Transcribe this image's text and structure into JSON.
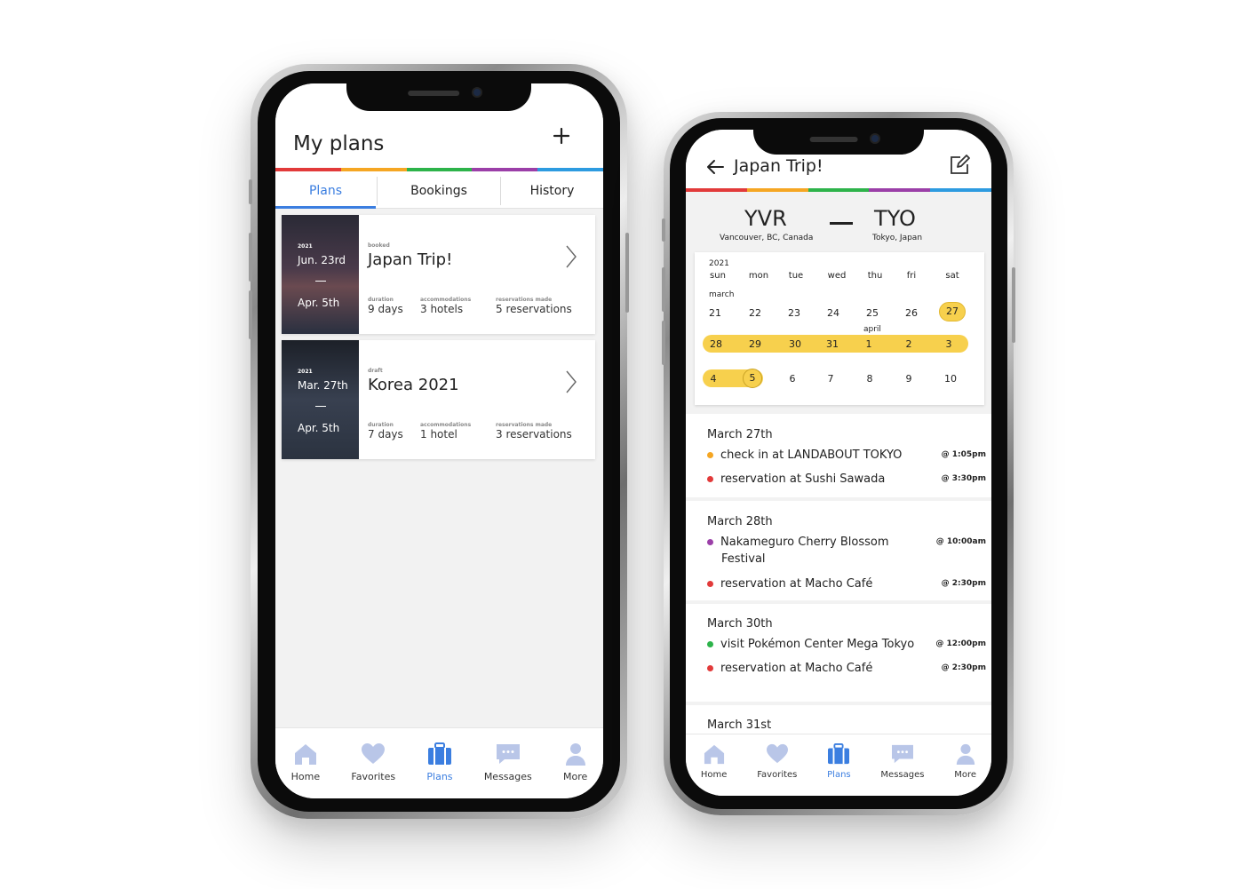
{
  "colors": {
    "red": "#e23a3a",
    "orange": "#f5a623",
    "green": "#2db34a",
    "purple": "#9b3fa8",
    "blue": "#2d9be0",
    "accent": "#3b7ee0",
    "yellow": "#f7d04d"
  },
  "left": {
    "title": "My plans",
    "add_icon": "plus-icon",
    "tabs": [
      "Plans",
      "Bookings",
      "History"
    ],
    "cards": [
      {
        "year": "2021",
        "start": "Jun. 23rd",
        "end": "Apr. 5th",
        "status": "booked",
        "name": "Japan Trip!",
        "duration_label": "duration",
        "duration": "9 days",
        "acc_label": "accommodations",
        "acc": "3 hotels",
        "res_label": "reservations made",
        "res": "5 reservations"
      },
      {
        "year": "2021",
        "start": "Mar. 27th",
        "end": "Apr. 5th",
        "status": "draft",
        "name": "Korea 2021",
        "duration_label": "duration",
        "duration": "7 days",
        "acc_label": "accommodations",
        "acc": "1 hotel",
        "res_label": "reservations made",
        "res": "3 reservations"
      }
    ],
    "nav": [
      "Home",
      "Favorites",
      "Plans",
      "Messages",
      "More"
    ]
  },
  "right": {
    "title": "Japan Trip!",
    "from_code": "YVR",
    "from_city": "Vancouver, BC, Canada",
    "to_code": "TYO",
    "to_city": "Tokyo, Japan",
    "dash": "—",
    "cal": {
      "year": "2021",
      "weekdays": [
        "sun",
        "mon",
        "tue",
        "wed",
        "thu",
        "fri",
        "sat"
      ],
      "month1": "march",
      "month2": "april",
      "week1": [
        "21",
        "22",
        "23",
        "24",
        "25",
        "26",
        "27"
      ],
      "week2": [
        "28",
        "29",
        "30",
        "31",
        "1",
        "2",
        "3"
      ],
      "week3": [
        "4",
        "5",
        "6",
        "7",
        "8",
        "9",
        "10"
      ]
    },
    "days": [
      {
        "date": "March 27th",
        "events": [
          {
            "text": "check in at LANDABOUT TOKYO",
            "time": "@ 1:05pm",
            "color": "#f5a623"
          },
          {
            "text": "reservation at Sushi Sawada",
            "time": "@ 3:30pm",
            "color": "#e23a3a"
          }
        ]
      },
      {
        "date": "March 28th",
        "events": [
          {
            "text": "Nakameguro Cherry Blossom",
            "text2": "Festival",
            "time": "@ 10:00am",
            "color": "#9b3fa8"
          },
          {
            "text": "reservation at Macho Café",
            "time": "@ 2:30pm",
            "color": "#e23a3a"
          }
        ]
      },
      {
        "date": "March 30th",
        "events": [
          {
            "text": "visit Pokémon Center Mega Tokyo",
            "time": "@ 12:00pm",
            "color": "#2db34a"
          },
          {
            "text": "reservation at Macho Café",
            "time": "@ 2:30pm",
            "color": "#e23a3a"
          }
        ]
      },
      {
        "date": "March 31st"
      }
    ],
    "nav": [
      "Home",
      "Favorites",
      "Plans",
      "Messages",
      "More"
    ]
  }
}
